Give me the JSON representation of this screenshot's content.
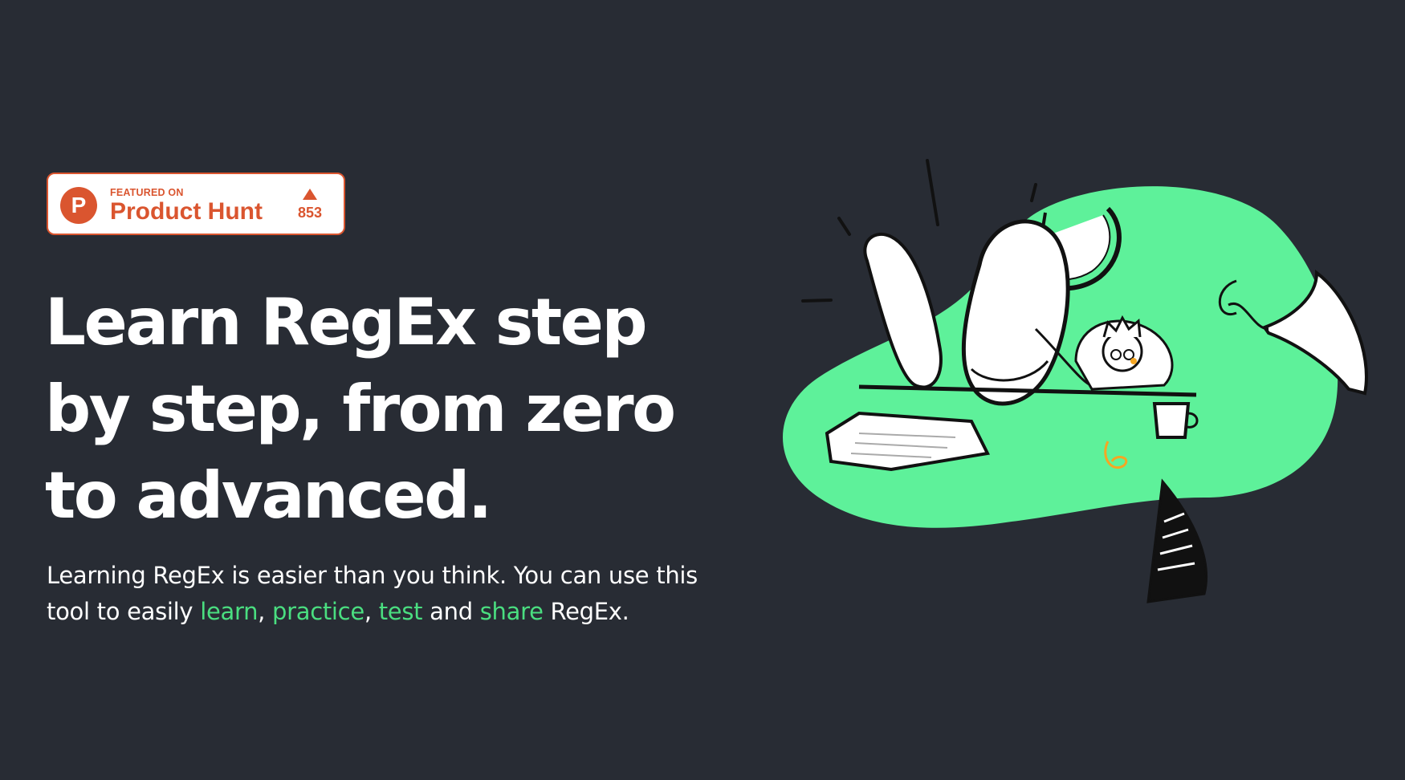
{
  "badge": {
    "featured_label": "FEATURED ON",
    "name": "Product Hunt",
    "logo_letter": "P",
    "vote_count": "853",
    "color": "#da552f"
  },
  "hero": {
    "headline": "Learn RegEx step by step, from zero to advanced.",
    "description": {
      "part1": "Learning RegEx is easier than you think. You can use this tool to easily ",
      "link_learn": "learn",
      "sep1": ", ",
      "link_practice": "practice",
      "sep2": ", ",
      "link_test": "test",
      "part2": " and ",
      "link_share": "share",
      "part3": " RegEx."
    }
  },
  "theme": {
    "background": "#282c34",
    "accent": "#4ade80",
    "blob": "#5ef19a",
    "text": "#ffffff"
  },
  "illustration": {
    "icon": "developer-relaxing-illustration"
  }
}
